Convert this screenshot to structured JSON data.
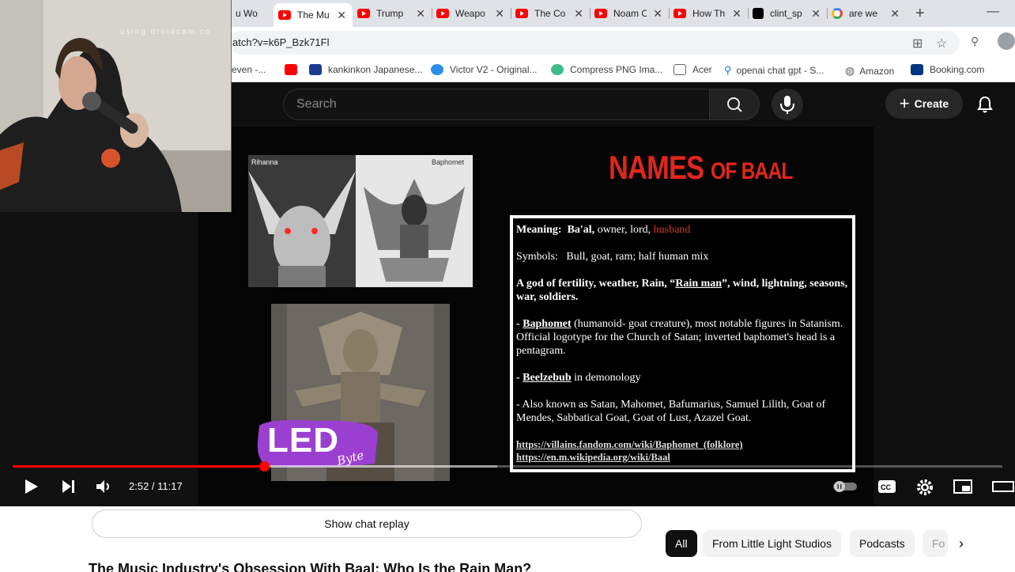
{
  "browser": {
    "tabs": [
      {
        "title": "u Wo",
        "icon": "youtube-icon"
      },
      {
        "title": "The Mu",
        "icon": "youtube-icon",
        "active": true
      },
      {
        "title": "Trump",
        "icon": "youtube-icon"
      },
      {
        "title": "Weapo",
        "icon": "youtube-icon"
      },
      {
        "title": "The Co",
        "icon": "youtube-icon"
      },
      {
        "title": "Noam C",
        "icon": "youtube-icon"
      },
      {
        "title": "How Th",
        "icon": "youtube-icon"
      },
      {
        "title": "clint_sp",
        "icon": "tiktok-icon"
      },
      {
        "title": "are we",
        "icon": "google-icon"
      }
    ],
    "url": "atch?v=k6P_Bzk71Fl",
    "bookmarks": [
      {
        "label": "even -...",
        "icon": "bookmark-icon"
      },
      {
        "label": "",
        "icon": "youtube-icon"
      },
      {
        "label": "kankinkon Japanese...",
        "icon": "dl-icon"
      },
      {
        "label": "Victor V2 - Original...",
        "icon": "victor-icon"
      },
      {
        "label": "Compress PNG Ima...",
        "icon": "panda-icon"
      },
      {
        "label": "Acer",
        "icon": "folder-icon"
      },
      {
        "label": "openai chat gpt - S...",
        "icon": "search-icon"
      },
      {
        "label": "Amazon",
        "icon": "globe-icon"
      },
      {
        "label": "Booking.com",
        "icon": "booking-icon"
      }
    ]
  },
  "youtube": {
    "search_placeholder": "Search",
    "create_label": "Create",
    "chat_replay": "Show chat replay",
    "chips": [
      "All",
      "From Little Light Studios",
      "Podcasts",
      "Fo"
    ],
    "video_title": "The Music Industry's Obsession With Baal: Who Is the Rain Man?"
  },
  "webcam": {
    "watermark": "using droidcam.co"
  },
  "slide": {
    "title_big": "NAMES",
    "title_small": "OF BAAL",
    "image_labels": {
      "rihanna": "Rihanna",
      "baphomet": "Baphomet"
    },
    "meaning_label": "Meaning:",
    "meaning_bold": "Ba'al,",
    "meaning_rest": "owner, lord,",
    "meaning_red": "husband",
    "symbols_label": "Symbols:",
    "symbols_text": "Bull, goat, ram; half human mix",
    "god_pre": "A god of fertility, weather, Rain, “",
    "god_link": "Rain man",
    "god_post": "”, wind, lightning, seasons, war, soldiers.",
    "bapho_dash": "-",
    "bapho_link": "Baphomet",
    "bapho_text": "(humanoid- goat creature), most notable figures in Satanism. Official logotype for the Church of Satan; inverted baphomet's head is a pentagram.",
    "beel_dash": "-",
    "beel_link": "Beelzebub",
    "beel_text": "in demonology",
    "aka_text": "- Also known as Satan, Mahomet, Bafumarius, Samuel Lilith, Goat of Mendes, Sabbatical Goat, Goat of Lust, Azazel Goat.",
    "link1": "https://villains.fandom.com/wiki/Baphomet_(folklore)",
    "link2": "https://en.m.wikipedia.org/wiki/Baal",
    "logo_text": "LED",
    "logo_sub": "Byte"
  },
  "player": {
    "current_time": "2:52",
    "separator": " / ",
    "duration": "11:17",
    "progress_fraction": 0.2541,
    "buffered_fraction": 0.49
  },
  "colors": {
    "youtube_red": "#ff0000",
    "slide_title": "#e0261c",
    "player_bg": "#0f0f0f"
  }
}
